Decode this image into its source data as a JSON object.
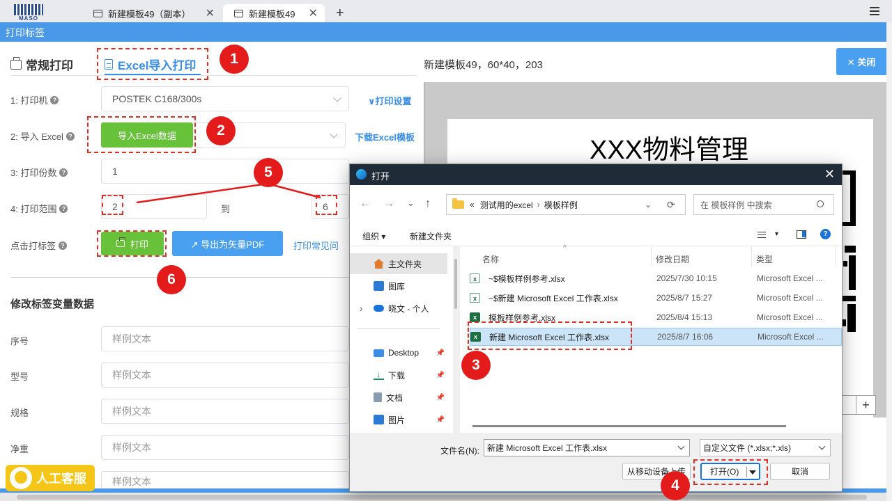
{
  "browser": {
    "logo_text": "MASO",
    "tabs": [
      {
        "label": "新建模板49（副本）"
      },
      {
        "label": "新建模板49"
      }
    ],
    "close_glyph": "✕",
    "new_tab_glyph": "+"
  },
  "app": {
    "title": "打印标签"
  },
  "left": {
    "tabs": {
      "normal": "常规打印",
      "excel": "Excel导入打印"
    },
    "fields": {
      "printer_label": "1: 打印机",
      "printer_value": "POSTEK C168/300s",
      "print_settings_link": "∨打印设置",
      "import_label": "2: 导入 Excel",
      "import_button": "导入Excel数据",
      "download_template_link": "下载Excel模板",
      "copies_label": "3: 打印份数",
      "copies_value": "1",
      "range_label": "4: 打印范围",
      "range_from": "2",
      "range_to_text": "到",
      "range_to": "6",
      "click_label": "点击打标签",
      "print_button": "打印",
      "export_pdf_button": "↗ 导出为矢量PDF",
      "faq_link": "打印常见问"
    },
    "variables": {
      "title": "修改标签变量数据",
      "rows": [
        {
          "label": "序号",
          "placeholder": "样例文本"
        },
        {
          "label": "型号",
          "placeholder": "样例文本"
        },
        {
          "label": "规格",
          "placeholder": "样例文本"
        },
        {
          "label": "净重",
          "placeholder": "样例文本"
        },
        {
          "label": "",
          "placeholder": "样例文本"
        }
      ]
    },
    "customer_service": "人工客服"
  },
  "right": {
    "template_info": "新建模板49，60*40，203",
    "close_button": "✕ 关闭",
    "label_title": "XXX物料管理",
    "zoom_plus": "+"
  },
  "badges": [
    "1",
    "2",
    "3",
    "4",
    "5",
    "6"
  ],
  "dialog": {
    "title": "打开",
    "close": "✕",
    "nav": {
      "back": "←",
      "forward": "→",
      "down": "⌄",
      "up": "↑",
      "refresh": "⟳"
    },
    "path": {
      "prefix": "«",
      "parent": "测试用的excel",
      "sep": "›",
      "current": "模板样例",
      "chevron": "⌄"
    },
    "search_placeholder": "在 模板样例 中搜索",
    "toolbar": {
      "organize": "组织 ▾",
      "new_folder": "新建文件夹",
      "view": "▾",
      "help": "?"
    },
    "sidebar": [
      {
        "label": "主文件夹",
        "icon": "home-icon",
        "pinned": false
      },
      {
        "label": "图库",
        "icon": "gallery-icon",
        "pinned": false
      },
      {
        "label": "晓文 - 个人",
        "icon": "cloud-icon",
        "pinned": false
      },
      {
        "label": "Desktop",
        "icon": "desktop-icon",
        "pinned": true
      },
      {
        "label": "下载",
        "icon": "download-icon",
        "pinned": true
      },
      {
        "label": "文档",
        "icon": "documents-icon",
        "pinned": true
      },
      {
        "label": "图片",
        "icon": "pictures-icon",
        "pinned": true
      }
    ],
    "pin_glyph": "📌",
    "expand_glyph": "›",
    "columns": {
      "name": "名称",
      "date": "修改日期",
      "type": "类型",
      "sort_glyph": "^"
    },
    "files": [
      {
        "name": "~$模板样例参考.xlsx",
        "date": "2025/7/30 10:15",
        "type": "Microsoft Excel ...",
        "temp": true
      },
      {
        "name": "~$新建 Microsoft Excel 工作表.xlsx",
        "date": "2025/8/7 15:27",
        "type": "Microsoft Excel ...",
        "temp": true
      },
      {
        "name": "模板样例参考.xlsx",
        "date": "2025/8/4 15:13",
        "type": "Microsoft Excel ...",
        "temp": false
      },
      {
        "name": "新建 Microsoft Excel 工作表.xlsx",
        "date": "2025/8/7 16:06",
        "type": "Microsoft Excel ...",
        "temp": false
      }
    ],
    "selected_index": 3,
    "filename_label": "文件名(N):",
    "filename_value": "新建 Microsoft Excel 工作表.xlsx",
    "filetype_value": "自定义文件 (*.xlsx;*.xls)",
    "mobile_upload": "从移动设备上传",
    "open_button": "打开(O)",
    "cancel_button": "取消"
  },
  "colors": {
    "accent": "#3a8ee6",
    "appbar": "#4a98e8",
    "green": "#67c23a",
    "red": "#e31b1b",
    "dialog_title": "#1f2b36"
  }
}
